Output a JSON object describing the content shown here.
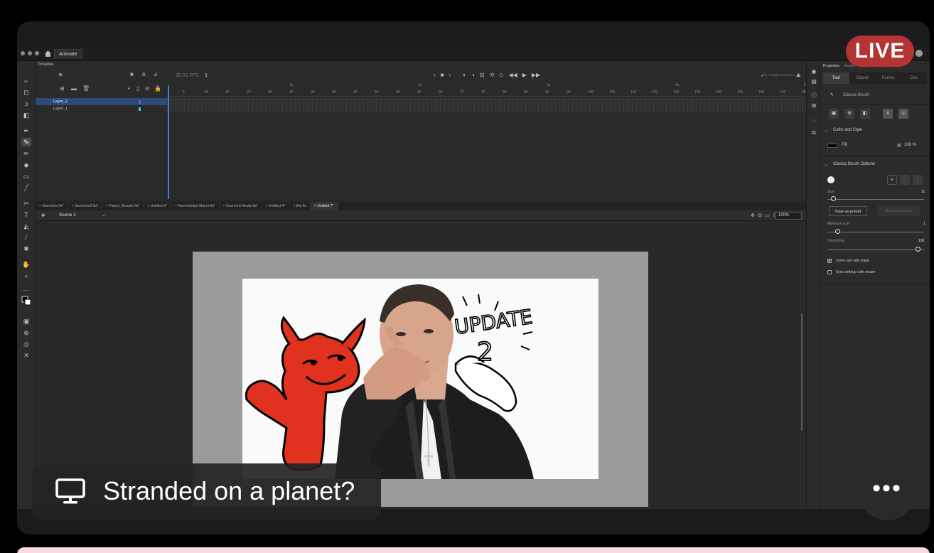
{
  "titlebar": {
    "app_tab": "Animate"
  },
  "timeline": {
    "label": "Timeline",
    "fps": "30.00 FPS",
    "frame": "1",
    "ruler_marks": [
      "5",
      "10",
      "15",
      "20",
      "25",
      "30",
      "35",
      "40",
      "45",
      "50",
      "55",
      "60",
      "65",
      "70",
      "75",
      "80",
      "85",
      "90",
      "95",
      "100",
      "105",
      "110",
      "115",
      "120",
      "125",
      "130",
      "135",
      "140",
      "145",
      "150"
    ],
    "ruler_seconds": [
      "1s",
      "2s",
      "3s",
      "4s",
      "5s"
    ],
    "layers": [
      {
        "name": "Layer_2",
        "selected": true
      },
      {
        "name": "Layer_1",
        "selected": false
      }
    ]
  },
  "doc_tabs": [
    "Gavroche.fla*",
    "Gavroche2.fla*",
    "Pianist_Beastie.fla*",
    "Untitled-2*",
    "Ravenbridge Manor.fla*",
    "GavrocheHeads.fla*",
    "Untitled-4*",
    "tlkk.fla",
    "Untitled-7*"
  ],
  "scene": {
    "name": "Scene 1",
    "zoom": "100%"
  },
  "stage": {
    "update_text_line1": "UPDATE",
    "update_text_line2": "2"
  },
  "properties": {
    "tabs": [
      "Properties",
      "Assets",
      "Align",
      "Library"
    ],
    "segments": [
      "Tool",
      "Object",
      "Frame",
      "Doc"
    ],
    "tool_name": "Classic Brush",
    "color_style_header": "Color and Style",
    "fill_label": "Fill",
    "fill_opacity": "100 %",
    "brush_options_header": "Classic Brush Options",
    "size_label": "Size",
    "size_value": "11",
    "save_preset": "Save as preset",
    "remove_preset": "Remove preset",
    "min_size_label": "Minimum size",
    "min_size_value": "1",
    "smoothing_label": "Smoothing",
    "smoothing_value": "100",
    "zoom_with_stage": "Zoom size with stage",
    "sync_eraser": "Sync settings with eraser"
  },
  "overlay": {
    "live_label": "LIVE",
    "caption": "Stranded on a planet?",
    "more_glyph": "•••"
  },
  "colors": {
    "live_red": "#b53333",
    "devil_red": "#e0321f",
    "selection_blue": "#2d4a78"
  }
}
